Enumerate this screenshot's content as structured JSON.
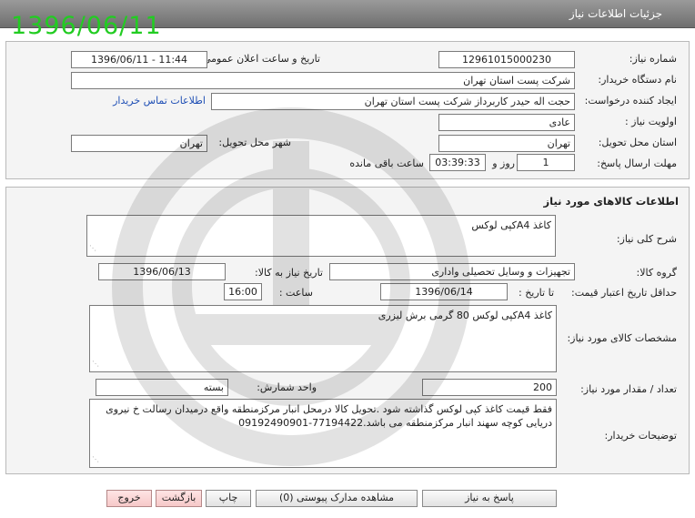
{
  "header": {
    "title": "جزئیات اطلاعات نیاز",
    "date_stamp": "1396/06/11"
  },
  "need_info": {
    "need_number_label": "شماره نیاز:",
    "need_number": "12961015000230",
    "announce_datetime_label": "تاریخ و ساعت اعلان عمومی:",
    "announce_datetime": "1396/06/11 - 11:44",
    "buyer_org_label": "نام دستگاه خریدار:",
    "buyer_org": "شرکت پست استان تهران",
    "creator_label": "ایجاد کننده درخواست:",
    "creator": "حجت اله حیدر کاربرداز شرکت پست استان تهران",
    "contact_link": "اطلاعات تماس خریدار",
    "priority_label": "اولویت نیاز :",
    "priority": "عادی",
    "province_label": "استان محل تحویل:",
    "province": "تهران",
    "city_label": "شهر محل تحویل:",
    "city": "تهران",
    "deadline_label": "مهلت ارسال پاسخ:",
    "deadline_days": "1",
    "day_and": "روز و",
    "deadline_time": "03:39:33",
    "remaining_label": "ساعت باقی مانده"
  },
  "goods": {
    "section_title": "اطلاعات کالاهای مورد نیاز",
    "general_desc_label": "شرح کلی نیاز:",
    "general_desc": "کاغذ A4کپی لوکس",
    "group_label": "گروه کالا:",
    "group": "تجهیزات و وسایل تحصیلی واداری",
    "need_date_label": "تاریخ نیاز به کالا:",
    "need_date": "1396/06/13",
    "min_validity_label": "حداقل تاریخ اعتبار قیمت:",
    "until_date_label": "تا تاریخ :",
    "until_date": "1396/06/14",
    "time_label": "ساعت :",
    "time": "16:00",
    "specs_label": "مشخصات کالای مورد نیاز:",
    "specs": "کاغذ A4کپی لوکس 80 گرمی برش لیزری",
    "quantity_label": "تعداد / مقدار مورد نیاز:",
    "quantity": "200",
    "unit_label": "واحد شمارش:",
    "unit": "بسته",
    "buyer_notes_label": "توضیحات خریدار:",
    "buyer_notes": "فقط قیمت کاغذ کپی لوکس گذاشته شود .تحویل کالا درمحل انبار مرکزمنطقه واقع درمیدان رسالت خ نیروی دریایی کوچه سهند انبار مرکزمنطقه می باشد.77194422-09192490901"
  },
  "buttons": {
    "reply": "پاسخ به نیاز",
    "attachments": "مشاهده مدارک پیوستی (0)",
    "print": "چاپ",
    "back": "بازگشت",
    "exit": "خروج"
  }
}
